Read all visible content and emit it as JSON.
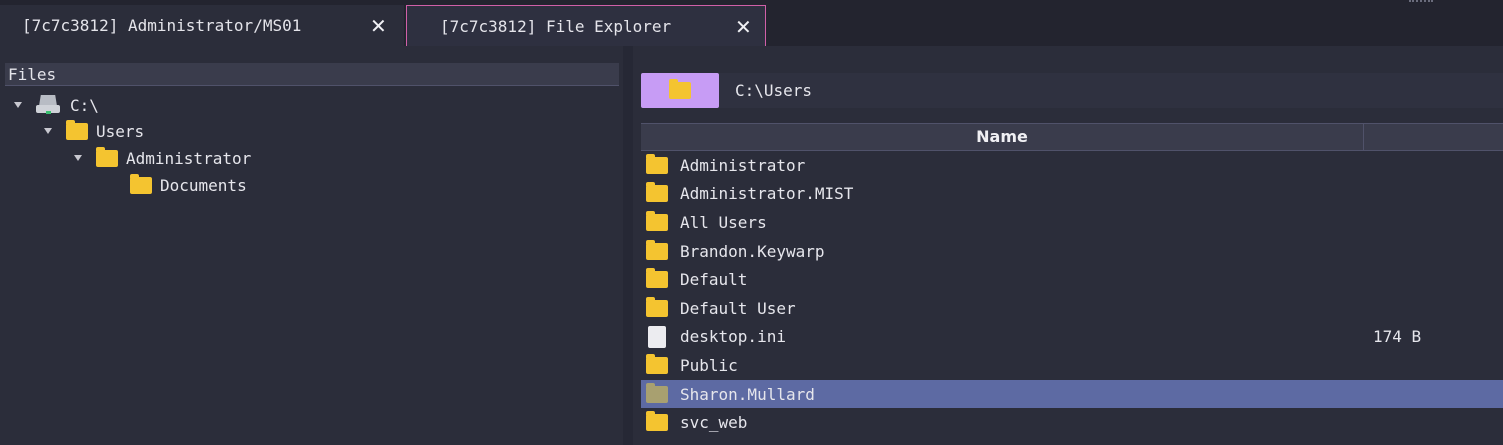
{
  "tabs": [
    {
      "label": "[7c7c3812] Administrator/MS01",
      "close": "✕"
    },
    {
      "label": "[7c7c3812] File Explorer",
      "close": "✕"
    }
  ],
  "tree": {
    "header": "Files",
    "nodes": [
      {
        "label": "C:\\",
        "icon": "drive-icon"
      },
      {
        "label": "Users",
        "icon": "folder-icon"
      },
      {
        "label": "Administrator",
        "icon": "folder-icon"
      },
      {
        "label": "Documents",
        "icon": "folder-icon"
      }
    ]
  },
  "path": {
    "value": "C:\\Users"
  },
  "table": {
    "columns": [
      "Name",
      ""
    ],
    "rows": [
      {
        "name": "Administrator",
        "type": "folder",
        "size": ""
      },
      {
        "name": "Administrator.MIST",
        "type": "folder",
        "size": ""
      },
      {
        "name": "All Users",
        "type": "folder",
        "size": ""
      },
      {
        "name": "Brandon.Keywarp",
        "type": "folder",
        "size": ""
      },
      {
        "name": "Default",
        "type": "folder",
        "size": ""
      },
      {
        "name": "Default User",
        "type": "folder",
        "size": ""
      },
      {
        "name": "desktop.ini",
        "type": "file",
        "size": "174 B"
      },
      {
        "name": "Public",
        "type": "folder",
        "size": ""
      },
      {
        "name": "Sharon.Mullard",
        "type": "folder",
        "size": "",
        "selected": true
      },
      {
        "name": "svc_web",
        "type": "folder",
        "size": ""
      }
    ]
  },
  "colors": {
    "accent_tab_border": "#d060a8",
    "path_button": "#c79cf5",
    "selection": "#5d6aa3",
    "folder": "#f4c430"
  }
}
